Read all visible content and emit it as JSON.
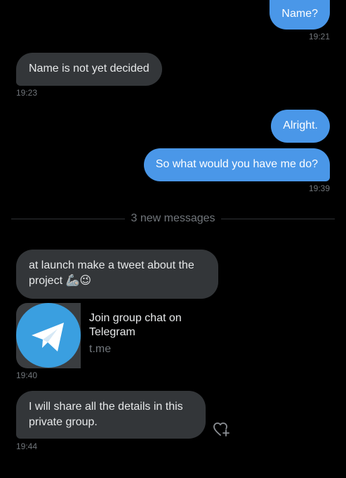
{
  "messages": [
    {
      "text": "Name?",
      "time": "19:21"
    },
    {
      "text": "Name is not yet decided",
      "time": "19:23"
    },
    {
      "text": "Alright."
    },
    {
      "text": "So what would you have me do?",
      "time": "19:39"
    },
    {
      "text": "at launch make a tweet about the project 🦾😉"
    },
    {
      "text": "I will share all the details in this private group.",
      "time": "19:44"
    }
  ],
  "divider": {
    "label": "3 new messages"
  },
  "link_card": {
    "title": "Join group chat on Telegram",
    "domain": "t.me",
    "time": "19:40",
    "icon": "telegram-icon"
  },
  "colors": {
    "outgoing_bubble": "#4a97e8",
    "incoming_bubble": "#333639",
    "background": "#000000",
    "muted_text": "#71767b"
  },
  "icons": {
    "reaction": "heart-plus-icon"
  }
}
